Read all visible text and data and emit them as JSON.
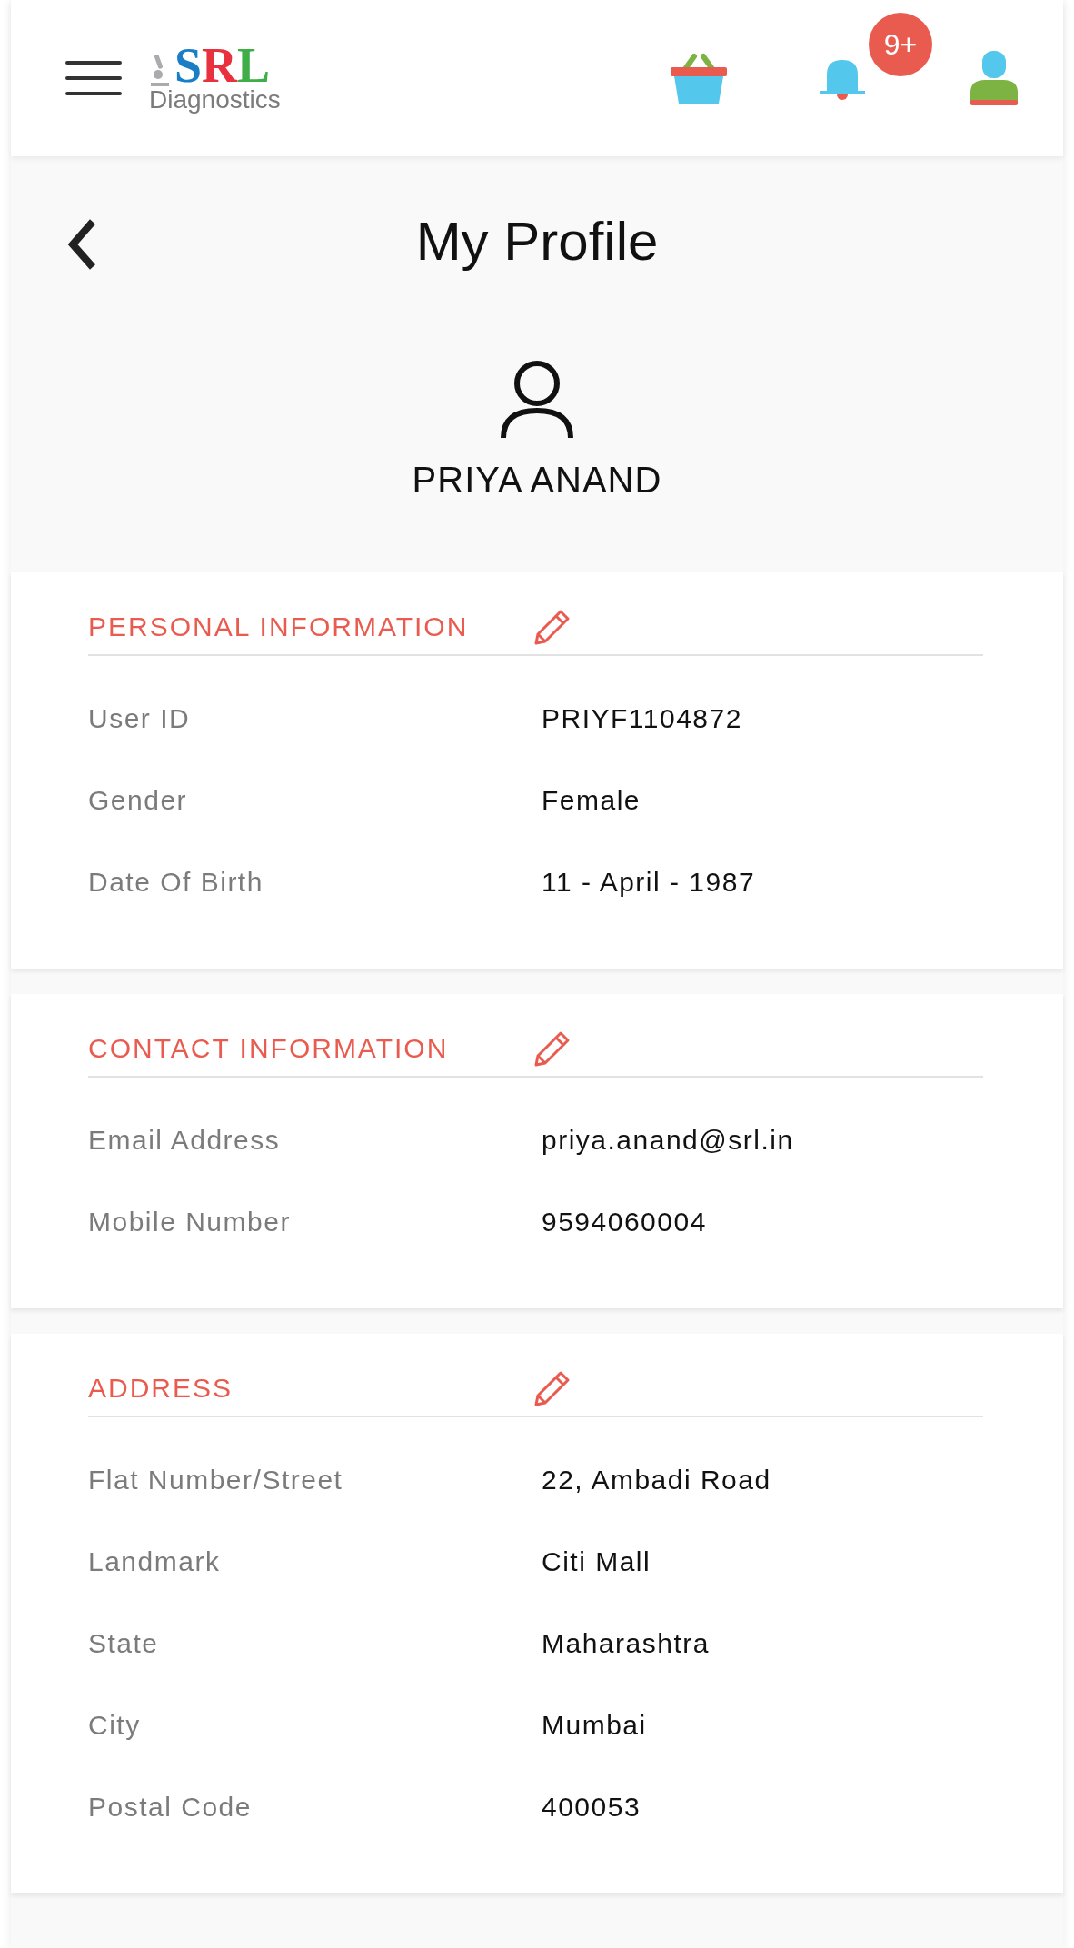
{
  "header": {
    "logo": {
      "letters": [
        {
          "text": "S",
          "color": "#1a7ec6"
        },
        {
          "text": "R",
          "color": "#e8303e"
        },
        {
          "text": "L",
          "color": "#3fae49"
        }
      ],
      "subtitle": "Diagnostics"
    },
    "notification_badge": "9+"
  },
  "profile": {
    "title": "My Profile",
    "name": "PRIYA ANAND"
  },
  "sections": [
    {
      "title": "PERSONAL INFORMATION",
      "fields": [
        {
          "label": "User ID",
          "value": "PRIYF1104872"
        },
        {
          "label": "Gender",
          "value": "Female"
        },
        {
          "label": "Date Of Birth",
          "value": "11 - April - 1987"
        }
      ]
    },
    {
      "title": "CONTACT INFORMATION",
      "fields": [
        {
          "label": "Email Address",
          "value": "priya.anand@srl.in"
        },
        {
          "label": "Mobile Number",
          "value": "9594060004"
        }
      ]
    },
    {
      "title": "ADDRESS",
      "fields": [
        {
          "label": "Flat Number/Street",
          "value": "22, Ambadi Road"
        },
        {
          "label": "Landmark",
          "value": "Citi Mall"
        },
        {
          "label": "State",
          "value": "Maharashtra"
        },
        {
          "label": "City",
          "value": "Mumbai"
        },
        {
          "label": "Postal Code",
          "value": "400053"
        }
      ]
    }
  ]
}
